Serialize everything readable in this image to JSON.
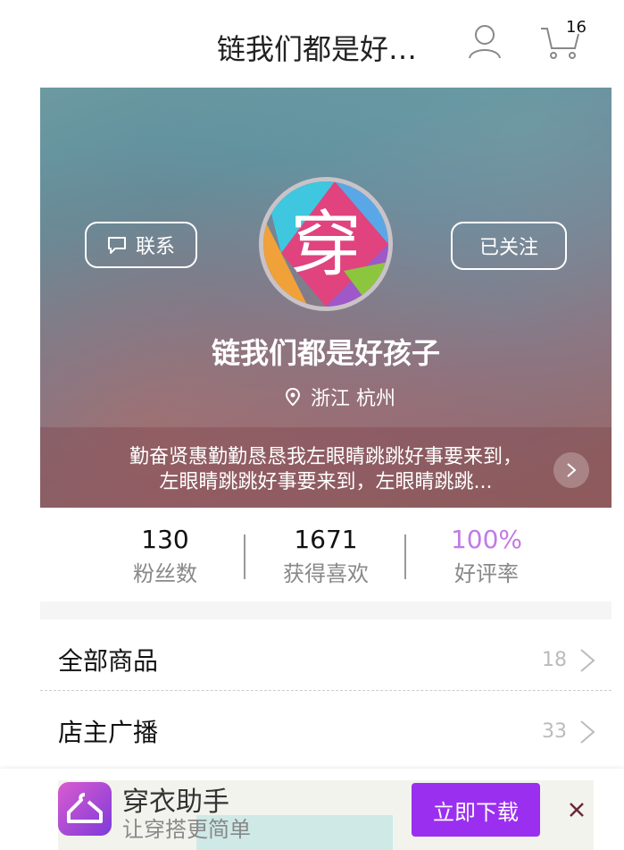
{
  "header": {
    "title": "链我们都是好孩...",
    "cart_count": "16"
  },
  "hero": {
    "contact_label": "联系",
    "follow_label": "已关注",
    "shop_name": "链我们都是好孩子",
    "location": "浙江 杭州",
    "description": "勤奋贤惠勤勤恳恳我左眼睛跳跳好事要来到，左眼睛跳跳好事要来到，左眼睛跳跳...",
    "avatar_char": "穿"
  },
  "stats": [
    {
      "value": "130",
      "label": "粉丝数"
    },
    {
      "value": "1671",
      "label": "获得喜欢"
    },
    {
      "value": "100%",
      "label": "好评率"
    }
  ],
  "colors": {
    "accent": "#c17ae6",
    "download": "#9b2ff0"
  },
  "list": [
    {
      "label": "全部商品",
      "count": "18"
    },
    {
      "label": "店主广播",
      "count": "33"
    }
  ],
  "banner": {
    "app_name": "穿衣助手",
    "slogan": "让穿搭更简单",
    "download_label": "立即下载"
  }
}
